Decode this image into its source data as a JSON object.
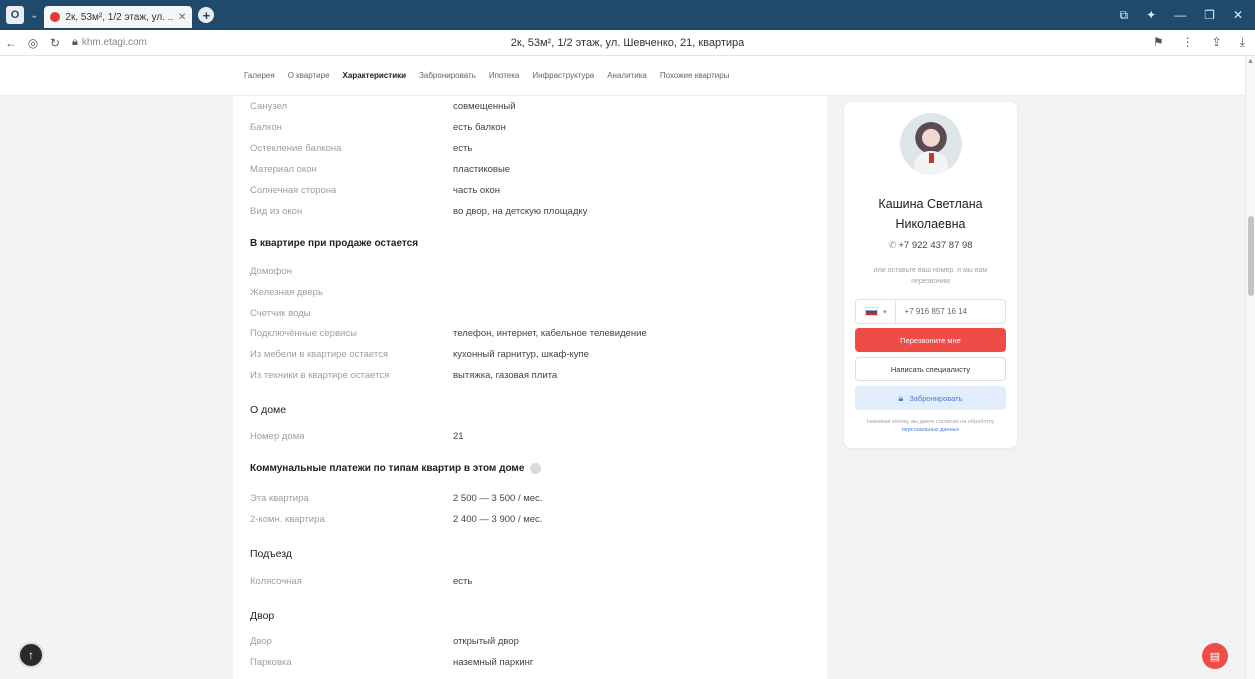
{
  "browser": {
    "tab_title": "2к, 53м², 1/2 этаж, ул. ...",
    "url": "khm.etagi.com",
    "page_title": "2к, 53м², 1/2 этаж, ул. Шевченко, 21, квартира"
  },
  "nav": {
    "items": [
      {
        "label": "Галерея"
      },
      {
        "label": "О квартире"
      },
      {
        "label": "Характеристики",
        "active": true
      },
      {
        "label": "Забронировать"
      },
      {
        "label": "Ипотека"
      },
      {
        "label": "Инфраструктура"
      },
      {
        "label": "Аналитика"
      },
      {
        "label": "Похожие квартиры"
      }
    ]
  },
  "props_top": [
    {
      "k": "Санузел",
      "v": "совмещенный"
    },
    {
      "k": "Балкон",
      "v": "есть балкон"
    },
    {
      "k": "Остекление балкона",
      "v": "есть"
    },
    {
      "k": "Материал окон",
      "v": "пластиковые"
    },
    {
      "k": "Солнечная сторона",
      "v": "часть окон"
    },
    {
      "k": "Вид из окон",
      "v": "во двор, на детскую площадку"
    }
  ],
  "section_remains": {
    "title": "В квартире при продаже остается",
    "rows": [
      {
        "k": "Домофон",
        "v": ""
      },
      {
        "k": "Железная дверь",
        "v": ""
      },
      {
        "k": "Счетчик воды",
        "v": ""
      },
      {
        "k": "Подключённые сервисы",
        "v": "телефон, интернет, кабельное телевидение"
      },
      {
        "k": "Из мебели в квартире остается",
        "v": "кухонный гарнитур, шкаф-купе"
      },
      {
        "k": "Из техники в квартире остается",
        "v": "вытяжка, газовая плита"
      }
    ]
  },
  "section_house": {
    "title": "О доме",
    "rows": [
      {
        "k": "Номер дома",
        "v": "21"
      }
    ]
  },
  "section_utilities": {
    "title": "Коммунальные платежи по типам квартир в этом доме",
    "rows": [
      {
        "k": "Эта квартира",
        "v": "2 500 — 3 500 / мес."
      },
      {
        "k": "2-комн. квартира",
        "v": "2 400 — 3 900 / мес."
      }
    ]
  },
  "section_entrance": {
    "title": "Подъезд",
    "rows": [
      {
        "k": "Колясочная",
        "v": "есть"
      }
    ]
  },
  "section_yard": {
    "title": "Двор",
    "rows": [
      {
        "k": "Двор",
        "v": "открытый двор"
      },
      {
        "k": "Парковка",
        "v": "наземный паркинг"
      }
    ]
  },
  "agent": {
    "name_line1": "Кашина Светлана",
    "name_line2": "Николаевна",
    "phone": "+7 922 437 87 98",
    "leave_text": "или оставьте ваш номер, и мы вам перезвоним",
    "input_value": "+7 916 857 16 14",
    "call_button": "Перезвоните мне",
    "write_button": "Написать специалисту",
    "book_button": "Забронировать",
    "consent_text": "Нажимая кнопку, вы даете согласие на обработку ",
    "consent_link": "персональных данных"
  },
  "colors": {
    "accent_red": "#ef4b47",
    "accent_blue": "#3f7be0",
    "chrome_blue": "#1f4a6b"
  }
}
